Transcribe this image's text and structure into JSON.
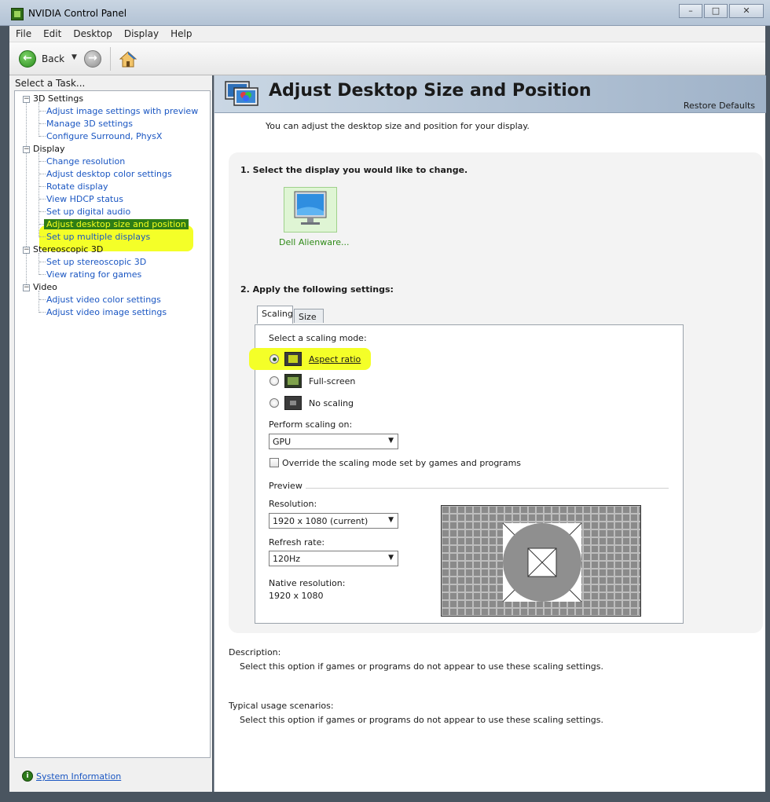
{
  "window": {
    "title": "NVIDIA Control Panel"
  },
  "menu": [
    "File",
    "Edit",
    "Desktop",
    "Display",
    "Help"
  ],
  "toolbar": {
    "back_label": "Back"
  },
  "sidebar": {
    "task_label": "Select a Task...",
    "groups": [
      {
        "label": "3D Settings",
        "items": [
          "Adjust image settings with preview",
          "Manage 3D settings",
          "Configure Surround, PhysX"
        ]
      },
      {
        "label": "Display",
        "items": [
          "Change resolution",
          "Adjust desktop color settings",
          "Rotate display",
          "View HDCP status",
          "Set up digital audio",
          "Adjust desktop size and position",
          "Set up multiple displays"
        ]
      },
      {
        "label": "Stereoscopic 3D",
        "items": [
          "Set up stereoscopic 3D",
          "View rating for games"
        ]
      },
      {
        "label": "Video",
        "items": [
          "Adjust video color settings",
          "Adjust video image settings"
        ]
      }
    ],
    "selected": "Adjust desktop size and position",
    "system_info": "System Information"
  },
  "page": {
    "title": "Adjust Desktop Size and Position",
    "restore": "Restore Defaults",
    "intro": "You can adjust the desktop size and position for your display.",
    "step1": "1. Select the display you would like to change.",
    "display_name": "Dell Alienware...",
    "step2": "2. Apply the following settings:",
    "tabs": [
      "Scaling",
      "Size"
    ],
    "scaling_prompt": "Select a scaling mode:",
    "modes": [
      "Aspect ratio",
      "Full-screen",
      "No scaling"
    ],
    "selected_mode": "Aspect ratio",
    "perform_label": "Perform scaling on:",
    "perform_value": "GPU",
    "override_label": "Override the scaling mode set by games and programs",
    "override_checked": false,
    "preview_label": "Preview",
    "resolution_label": "Resolution:",
    "resolution_value": "1920 x 1080 (current)",
    "refresh_label": "Refresh rate:",
    "refresh_value": "120Hz",
    "native_label": "Native resolution:",
    "native_value": "1920 x 1080",
    "description_heading": "Description:",
    "description_text": "Select this option if games or programs do not appear to use these scaling settings.",
    "usage_heading": "Typical usage scenarios:",
    "usage_text": "Select this option if games or programs do not appear to use these scaling settings."
  },
  "colors": {
    "nvidia_green": "#2e7d16",
    "link_blue": "#1a56c2",
    "highlight": "#f4ff28"
  }
}
